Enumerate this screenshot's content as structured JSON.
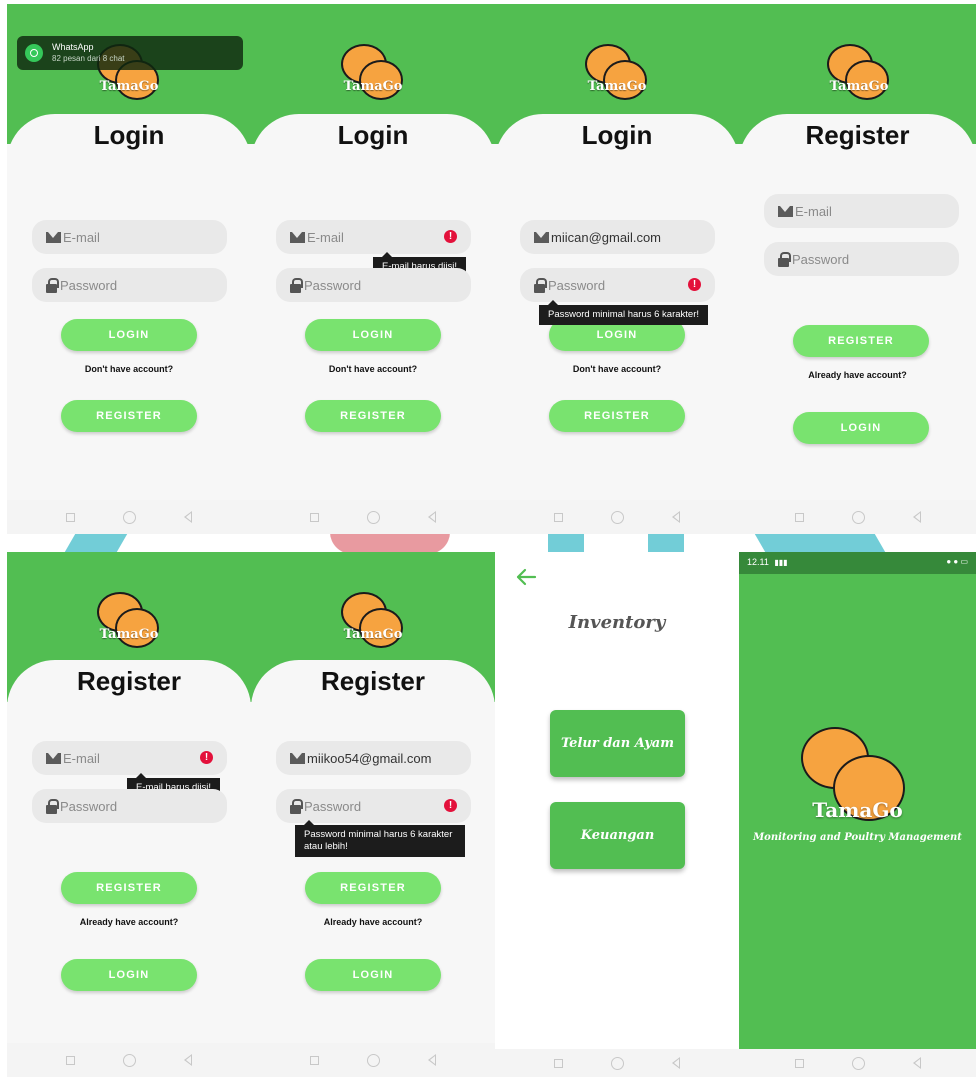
{
  "colors": {
    "brand_green": "#52be52",
    "button_green": "#79e36f",
    "error_red": "#e3113b",
    "field_bg": "#e9e9e9"
  },
  "app": {
    "logo_text": "TamaGo",
    "subtitle": "Monitoring and Poultry Management"
  },
  "notification": {
    "app": "WhatsApp",
    "message": "82 pesan dari 8 chat"
  },
  "login": {
    "title": "Login",
    "email_placeholder": "E-mail",
    "password_placeholder": "Password",
    "login_label": "LOGIN",
    "no_account": "Don't have account?",
    "register_label": "REGISTER",
    "email_error": "E-mail harus diisi!",
    "password_error": "Password minimal harus 6 karakter!",
    "email_value": "miican@gmail.com"
  },
  "register": {
    "title": "Register",
    "email_placeholder": "E-mail",
    "password_placeholder": "Password",
    "register_label": "REGISTER",
    "have_account": "Already have account?",
    "login_label": "LOGIN",
    "email_error": "E-mail harus diisi!",
    "password_error_line1": "Password minimal harus 6 karakter",
    "password_error_line2": "atau lebih!",
    "email_value": "miikoo54@gmail.com"
  },
  "inventory": {
    "title": "Inventory",
    "button_1": "Telur dan Ayam",
    "button_2": "Keuangan"
  },
  "status_bar": {
    "time": "12.11"
  },
  "icons": [
    "envelope-icon",
    "lock-icon",
    "error-icon",
    "back-arrow-icon",
    "whatsapp-icon",
    "nav-square-icon",
    "nav-home-icon",
    "nav-back-icon"
  ]
}
